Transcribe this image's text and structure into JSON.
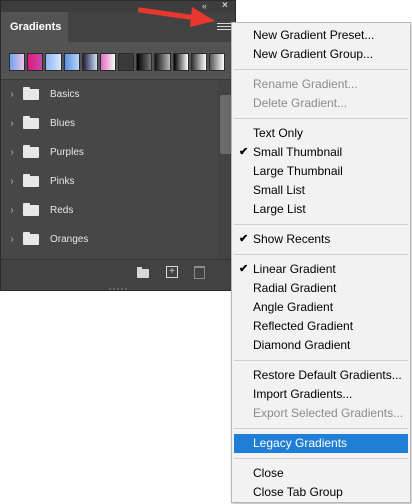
{
  "panel": {
    "tab_label": "Gradients",
    "collapse_glyph": "«",
    "close_glyph": "×",
    "presets": [
      {
        "icon": "gradient-swatch",
        "colors": [
          "#6fa3ee",
          "#f0c2e9"
        ]
      },
      {
        "icon": "gradient-swatch",
        "colors": [
          "#e0187d",
          "#c44aa6"
        ]
      },
      {
        "icon": "gradient-swatch",
        "colors": [
          "#8fb6f0",
          "#d7e7ff"
        ]
      },
      {
        "icon": "gradient-swatch",
        "colors": [
          "#5c8fe6",
          "#b9d6f6"
        ]
      },
      {
        "icon": "gradient-swatch",
        "colors": [
          "#1e1e3a",
          "#cfe0f5"
        ]
      },
      {
        "icon": "gradient-swatch",
        "colors": [
          "#e06cc0",
          "#f8f8f8"
        ]
      },
      {
        "icon": "gradient-swatch",
        "colors": [
          "#3a3a3a",
          "#3a3a3a"
        ]
      },
      {
        "icon": "gradient-swatch",
        "colors": [
          "#000000",
          "#777777"
        ]
      },
      {
        "icon": "gradient-swatch",
        "colors": [
          "#111111",
          "#bbbbbb"
        ]
      },
      {
        "icon": "gradient-swatch",
        "colors": [
          "#000000",
          "#ffffff"
        ]
      },
      {
        "icon": "gradient-swatch",
        "colors": [
          "#333333",
          "#ffffff"
        ]
      },
      {
        "icon": "gradient-swatch",
        "colors": [
          "#555555",
          "#ffffff"
        ]
      }
    ],
    "groups": [
      {
        "label": "Basics"
      },
      {
        "label": "Blues"
      },
      {
        "label": "Purples"
      },
      {
        "label": "Pinks"
      },
      {
        "label": "Reds"
      },
      {
        "label": "Oranges"
      }
    ],
    "footer_new_glyph": "+",
    "colors": {
      "panel_bg": "#535353",
      "list_bg": "#474747"
    }
  },
  "menu": {
    "items": [
      {
        "label": "New Gradient Preset...",
        "enabled": true,
        "checked": false
      },
      {
        "label": "New Gradient Group...",
        "enabled": true,
        "checked": false
      },
      {
        "separator": true
      },
      {
        "label": "Rename Gradient...",
        "enabled": false,
        "checked": false
      },
      {
        "label": "Delete Gradient...",
        "enabled": false,
        "checked": false
      },
      {
        "separator": true
      },
      {
        "label": "Text Only",
        "enabled": true,
        "checked": false
      },
      {
        "label": "Small Thumbnail",
        "enabled": true,
        "checked": true
      },
      {
        "label": "Large Thumbnail",
        "enabled": true,
        "checked": false
      },
      {
        "label": "Small List",
        "enabled": true,
        "checked": false
      },
      {
        "label": "Large List",
        "enabled": true,
        "checked": false
      },
      {
        "separator": true
      },
      {
        "label": "Show Recents",
        "enabled": true,
        "checked": true
      },
      {
        "separator": true
      },
      {
        "label": "Linear Gradient",
        "enabled": true,
        "checked": true
      },
      {
        "label": "Radial Gradient",
        "enabled": true,
        "checked": false
      },
      {
        "label": "Angle Gradient",
        "enabled": true,
        "checked": false
      },
      {
        "label": "Reflected Gradient",
        "enabled": true,
        "checked": false
      },
      {
        "label": "Diamond Gradient",
        "enabled": true,
        "checked": false
      },
      {
        "separator": true
      },
      {
        "label": "Restore Default Gradients...",
        "enabled": true,
        "checked": false
      },
      {
        "label": "Import Gradients...",
        "enabled": true,
        "checked": false
      },
      {
        "label": "Export Selected Gradients...",
        "enabled": false,
        "checked": false
      },
      {
        "separator": true
      },
      {
        "label": "Legacy Gradients",
        "enabled": true,
        "checked": false,
        "highlighted": true
      },
      {
        "separator": true
      },
      {
        "label": "Close",
        "enabled": true,
        "checked": false
      },
      {
        "label": "Close Tab Group",
        "enabled": true,
        "checked": false
      }
    ],
    "check_glyph": "✔",
    "highlight_color": "#1f7ed6"
  },
  "annotation": {
    "arrow_color": "#e8372e"
  }
}
